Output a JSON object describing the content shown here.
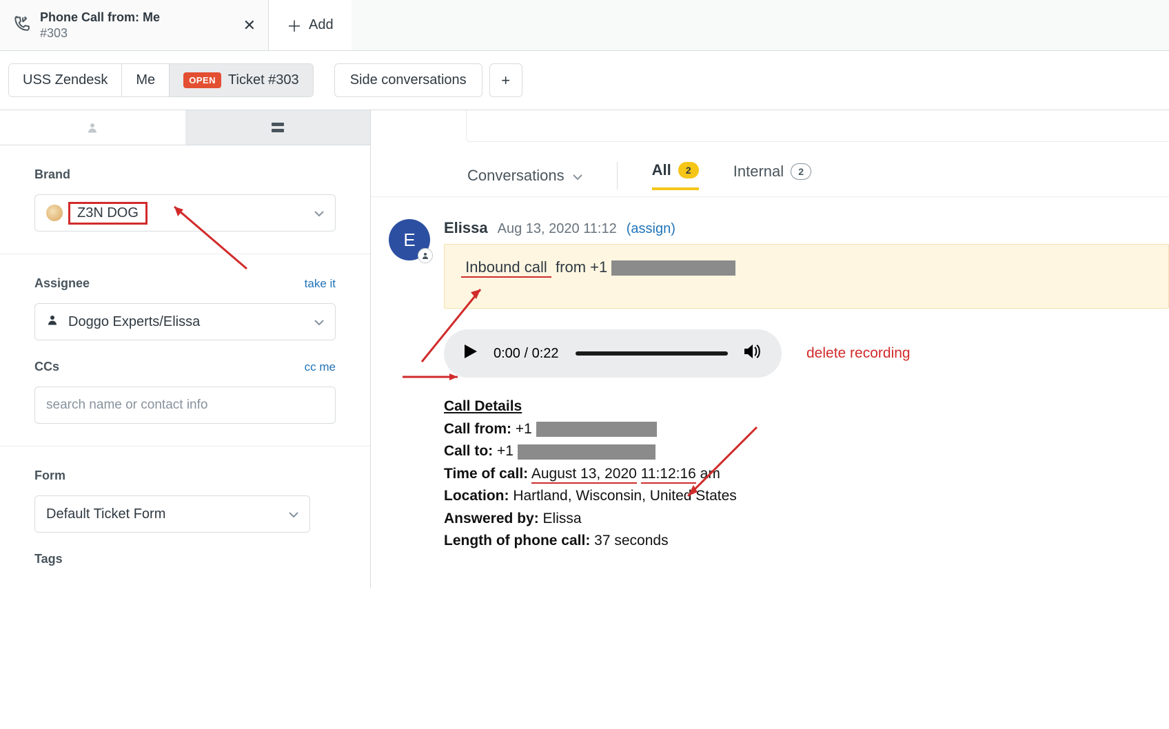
{
  "tab": {
    "title": "Phone Call from: Me",
    "subtitle": "#303",
    "add_label": "Add"
  },
  "breadcrumb": {
    "org": "USS Zendesk",
    "requester": "Me",
    "status": "OPEN",
    "ticket_label": "Ticket #303",
    "side_conversations": "Side conversations"
  },
  "sidebar": {
    "brand_label": "Brand",
    "brand_value": "Z3N DOG",
    "assignee_label": "Assignee",
    "assignee_takeit": "take it",
    "assignee_value": "Doggo Experts/Elissa",
    "ccs_label": "CCs",
    "ccs_ccme": "cc me",
    "ccs_placeholder": "search name or contact info",
    "form_label": "Form",
    "form_value": "Default Ticket Form",
    "tags_label": "Tags"
  },
  "conversations": {
    "title": "Conversations",
    "filters": {
      "all_label": "All",
      "all_count": "2",
      "internal_label": "Internal",
      "internal_count": "2"
    }
  },
  "event": {
    "avatar_letter": "E",
    "author": "Elissa",
    "timestamp": "Aug 13, 2020 11:12",
    "assign": "(assign)",
    "note_prefix": "Inbound call",
    "note_mid": " from +1 "
  },
  "audio": {
    "current": "0:00",
    "total": "0:22",
    "delete_label": "delete recording"
  },
  "call": {
    "header": "Call Details",
    "from_label": "Call from:",
    "from_value": " +1 ",
    "to_label": "Call to:",
    "to_value": " +1 ",
    "time_label": "Time of call:",
    "time_value_a": "August 13, 2020",
    "time_value_b": "11:12:16",
    "time_value_c": " am",
    "location_label": "Location:",
    "location_value": " Hartland, Wisconsin, United States",
    "answered_label": "Answered by:",
    "answered_value": " Elissa",
    "length_label": "Length of phone call:",
    "length_value": " 37 seconds"
  }
}
